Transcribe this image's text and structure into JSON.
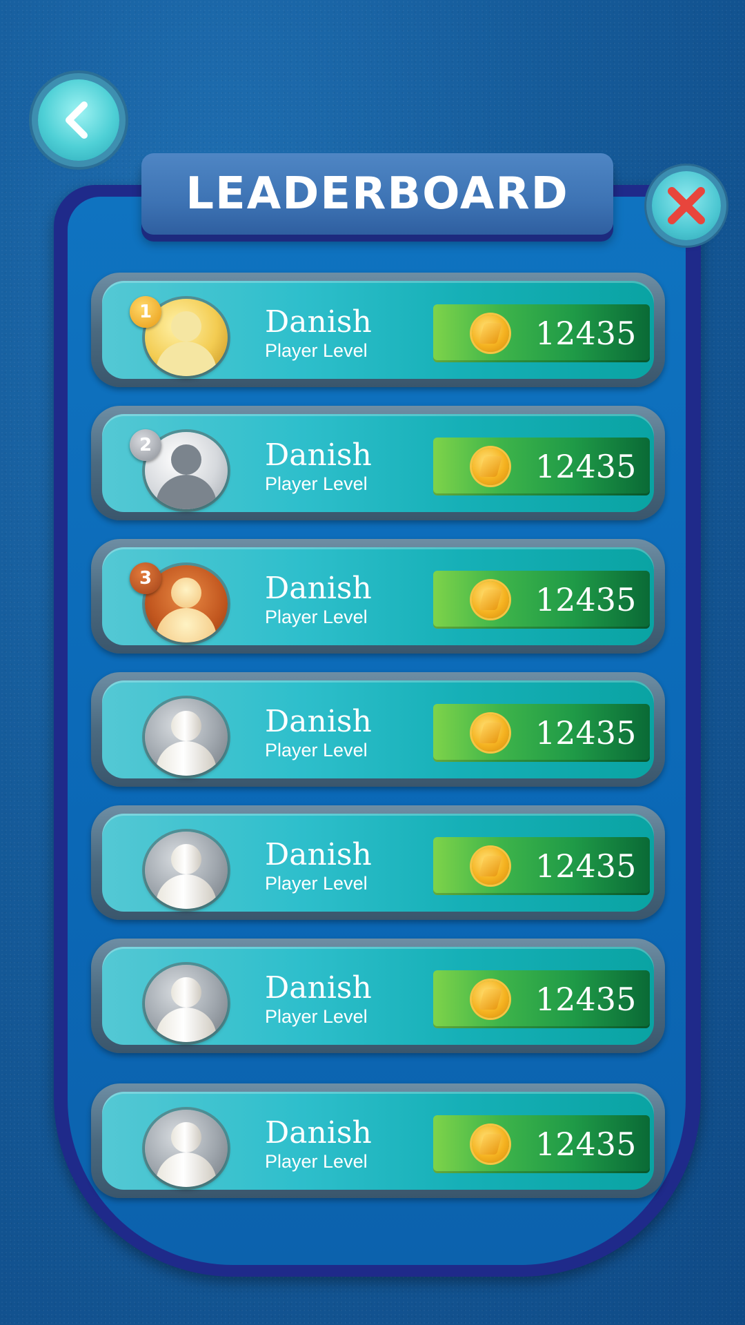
{
  "header": {
    "title": "LEADERBOARD",
    "back_icon": "chevron-left-icon",
    "close_icon": "close-x-icon"
  },
  "colors": {
    "panel_border": "#1f2a8a",
    "panel_fill": "#0f73c0",
    "row_face": "#2fbfcc",
    "score_green": "#1f9a47",
    "close_x": "#e8453c"
  },
  "players": [
    {
      "rank": "1",
      "tier": "gold",
      "name": "Danish",
      "level_label": "Player Level",
      "score": "12435"
    },
    {
      "rank": "2",
      "tier": "silver",
      "name": "Danish",
      "level_label": "Player Level",
      "score": "12435"
    },
    {
      "rank": "3",
      "tier": "bronze",
      "name": "Danish",
      "level_label": "Player Level",
      "score": "12435"
    },
    {
      "rank": "",
      "tier": "plain",
      "name": "Danish",
      "level_label": "Player Level",
      "score": "12435"
    },
    {
      "rank": "",
      "tier": "plain",
      "name": "Danish",
      "level_label": "Player Level",
      "score": "12435"
    },
    {
      "rank": "",
      "tier": "plain",
      "name": "Danish",
      "level_label": "Player Level",
      "score": "12435"
    },
    {
      "rank": "",
      "tier": "plain",
      "name": "Danish",
      "level_label": "Player Level",
      "score": "12435"
    }
  ]
}
